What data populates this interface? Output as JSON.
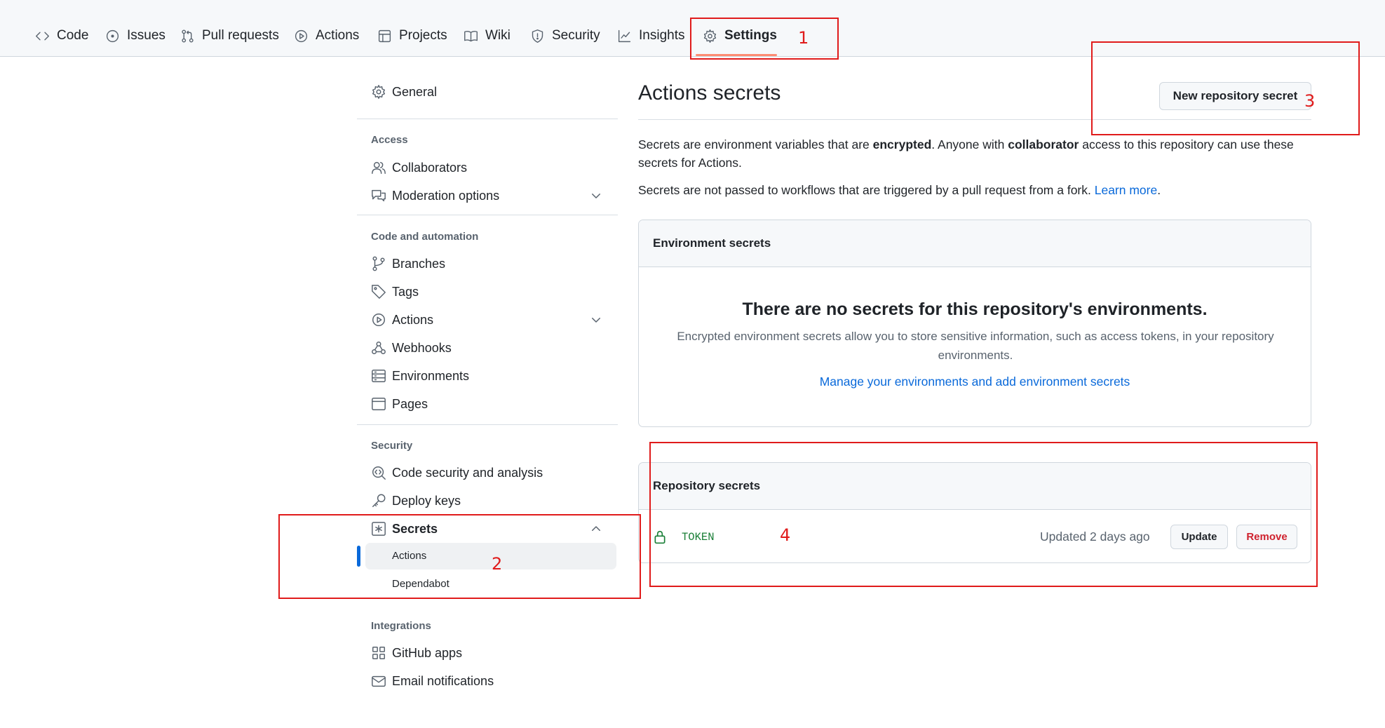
{
  "nav": {
    "tabs": [
      {
        "label": "Code",
        "icon": "code-icon"
      },
      {
        "label": "Issues",
        "icon": "issue-icon"
      },
      {
        "label": "Pull requests",
        "icon": "pull-request-icon"
      },
      {
        "label": "Actions",
        "icon": "play-icon"
      },
      {
        "label": "Projects",
        "icon": "table-icon"
      },
      {
        "label": "Wiki",
        "icon": "book-icon"
      },
      {
        "label": "Security",
        "icon": "shield-icon"
      },
      {
        "label": "Insights",
        "icon": "graph-icon"
      },
      {
        "label": "Settings",
        "icon": "gear-icon",
        "selected": true
      }
    ]
  },
  "annotations": [
    "1",
    "2",
    "3",
    "4"
  ],
  "annotation_color": "#e01b1b",
  "sidebar": {
    "general": "General",
    "access_heading": "Access",
    "collaborators": "Collaborators",
    "moderation": "Moderation options",
    "code_heading": "Code and automation",
    "branches": "Branches",
    "tags": "Tags",
    "actions": "Actions",
    "webhooks": "Webhooks",
    "environments": "Environments",
    "pages": "Pages",
    "security_heading": "Security",
    "code_security": "Code security and analysis",
    "deploy_keys": "Deploy keys",
    "secrets": "Secrets",
    "secrets_actions": "Actions",
    "secrets_dependabot": "Dependabot",
    "integrations_heading": "Integrations",
    "github_apps": "GitHub apps",
    "email_notifications": "Email notifications"
  },
  "main": {
    "title": "Actions secrets",
    "new_secret_button": "New repository secret",
    "desc1_a": "Secrets are environment variables that are ",
    "desc1_b": "encrypted",
    "desc1_c": ". Anyone with ",
    "desc1_d": "collaborator",
    "desc1_e": " access to this repository can use these secrets for Actions.",
    "desc2": "Secrets are not passed to workflows that are triggered by a pull request from a fork. ",
    "learn_more": "Learn more",
    "desc2_end": ".",
    "env_panel": {
      "heading": "Environment secrets",
      "empty_title": "There are no secrets for this repository's environments.",
      "empty_text": "Encrypted environment secrets allow you to store sensitive information, such as access tokens, in your repository environments.",
      "manage_link": "Manage your environments and add environment secrets"
    },
    "repo_panel": {
      "heading": "Repository secrets",
      "secrets": [
        {
          "name": "TOKEN",
          "updated": "Updated 2 days ago",
          "update_label": "Update",
          "remove_label": "Remove"
        }
      ]
    }
  },
  "colors": {
    "accent": "#0969da",
    "success": "#1a7f37",
    "danger": "#cf222e",
    "tab_underline": "#fd8c73"
  }
}
